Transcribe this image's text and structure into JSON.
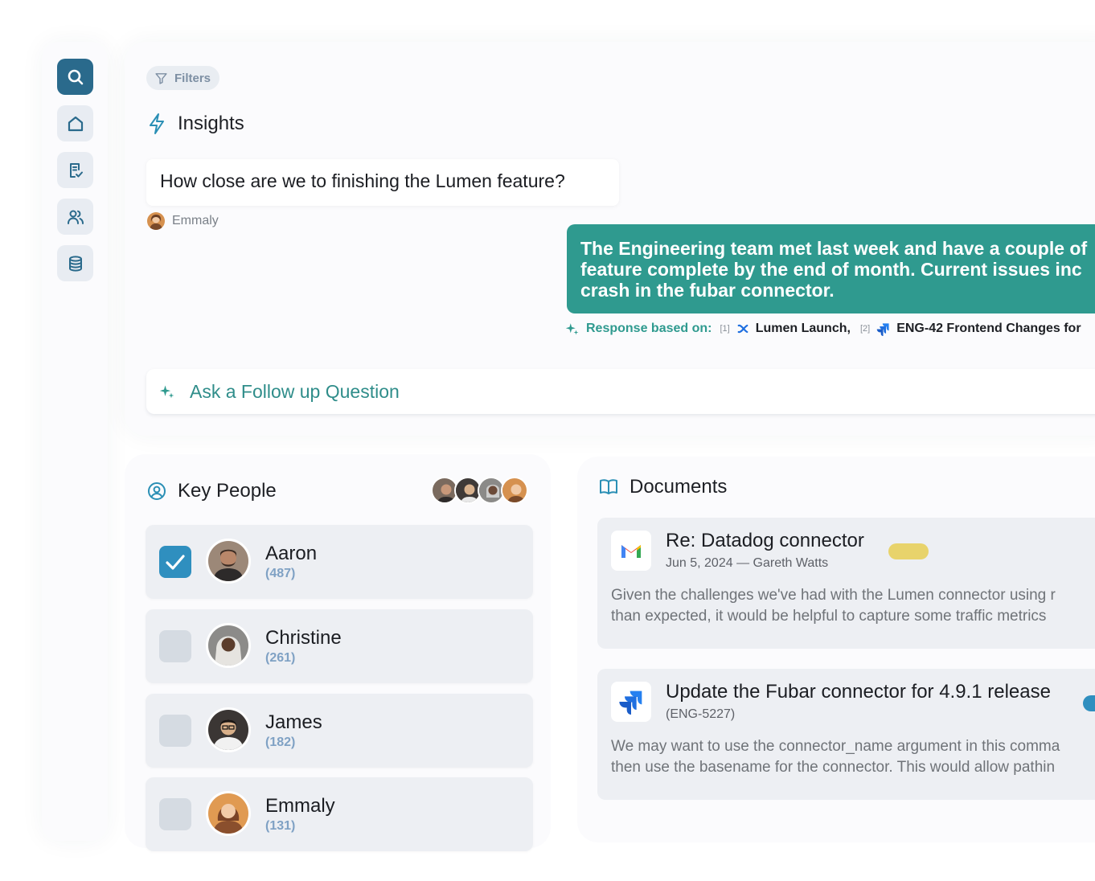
{
  "sidebar": {
    "items": [
      {
        "icon": "search-icon",
        "active": true
      },
      {
        "icon": "home-icon",
        "active": false
      },
      {
        "icon": "document-check-icon",
        "active": false
      },
      {
        "icon": "users-icon",
        "active": false
      },
      {
        "icon": "database-icon",
        "active": false
      }
    ]
  },
  "insights": {
    "filters_label": "Filters",
    "title": "Insights",
    "question": "How close are we to finishing the Lumen feature?",
    "asker": "Emmaly",
    "answer_lines": [
      "The Engineering team met last week and have a couple of",
      "feature complete by the end of month. Current issues inc",
      "crash in the fubar connector."
    ],
    "sources_label": "Response based on:",
    "sources": [
      {
        "ref": "[1]",
        "name": "Lumen Launch,",
        "icon": "confluence-icon"
      },
      {
        "ref": "[2]",
        "name": "ENG-42 Frontend Changes for",
        "icon": "jira-icon"
      }
    ],
    "followup_label": "Ask a Follow up Question"
  },
  "key_people": {
    "title": "Key People",
    "people": [
      {
        "name": "Aaron",
        "count": "(487)",
        "checked": true,
        "avatar_color": "#8a6a55"
      },
      {
        "name": "Christine",
        "count": "(261)",
        "checked": false,
        "avatar_color": "#5b4a3f"
      },
      {
        "name": "James",
        "count": "(182)",
        "checked": false,
        "avatar_color": "#4a3a33"
      },
      {
        "name": "Emmaly",
        "count": "(131)",
        "checked": false,
        "avatar_color": "#c98a55"
      }
    ]
  },
  "documents": {
    "title": "Documents",
    "items": [
      {
        "title": "Re: Datadog connector",
        "meta": "Jun 5, 2024 — Gareth Watts",
        "icon": "gmail-icon",
        "tag_color": "#e8d36b",
        "body": [
          "Given the challenges we've had with the Lumen connector using r",
          "than expected, it would be helpful to capture some traffic metrics"
        ]
      },
      {
        "title": "Update the Fubar connector for 4.9.1 release",
        "meta": "(ENG-5227)",
        "icon": "jira-icon",
        "tag_color": "#2f8fbf",
        "body": [
          "We may want to use the connector_name argument in this comma",
          "then use the basename for the connector. This would allow pathin"
        ]
      }
    ]
  },
  "colors": {
    "accent_teal": "#2f9a8f",
    "sidebar_active": "#2a6a8c",
    "checkbox_on": "#2f8fbf"
  }
}
